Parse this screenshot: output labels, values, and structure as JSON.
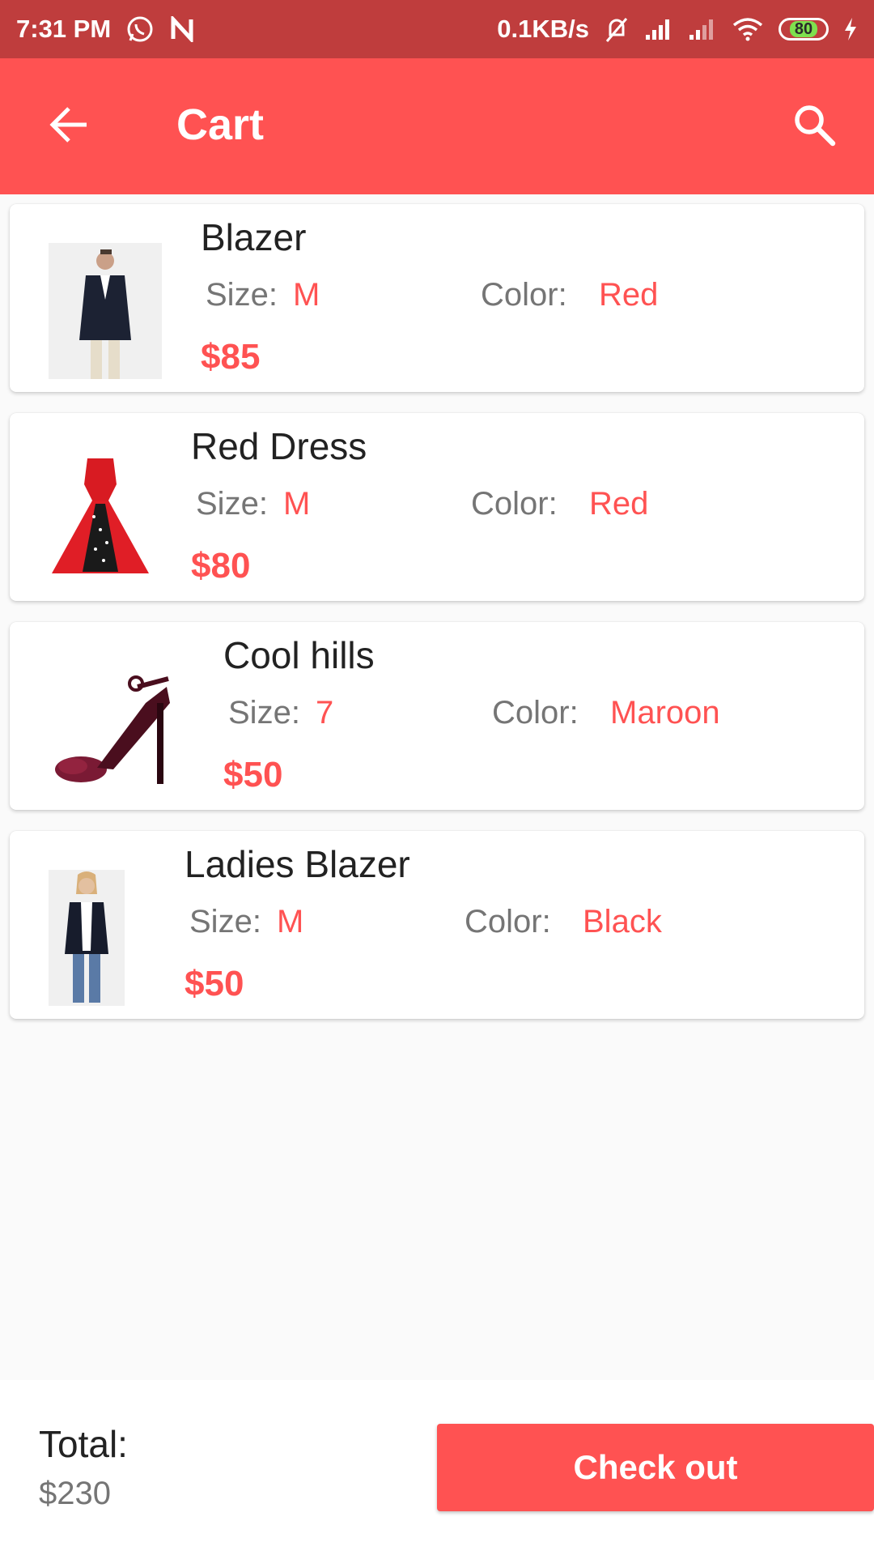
{
  "status_bar": {
    "time": "7:31 PM",
    "net_speed": "0.1KB/s",
    "battery": "80",
    "icons": [
      "whatsapp-icon",
      "n-notification-icon",
      "mute-bell-icon",
      "signal-icon",
      "signal-icon-2",
      "wifi-icon",
      "battery-icon",
      "charging-icon"
    ]
  },
  "app_bar": {
    "title": "Cart",
    "back_icon": "arrow-back-icon",
    "search_icon": "search-icon",
    "color": "#ff5252"
  },
  "labels": {
    "size": "Size:",
    "color": "Color:"
  },
  "items": [
    {
      "name": "Blazer",
      "size": "M",
      "color": "Red",
      "price": "$85",
      "image": "mens-blazer-image"
    },
    {
      "name": "Red Dress",
      "size": "M",
      "color": "Red",
      "price": "$80",
      "image": "red-dress-image"
    },
    {
      "name": "Cool hills",
      "size": "7",
      "color": "Maroon",
      "price": "$50",
      "image": "maroon-heel-image"
    },
    {
      "name": "Ladies Blazer",
      "size": "M",
      "color": "Black",
      "price": "$50",
      "image": "ladies-blazer-image"
    }
  ],
  "footer": {
    "total_label": "Total:",
    "total_value": "$230",
    "checkout_label": "Check out"
  },
  "colors": {
    "accent": "#ff5252",
    "status_bar": "#bf3d3d",
    "muted_text": "#757575"
  }
}
